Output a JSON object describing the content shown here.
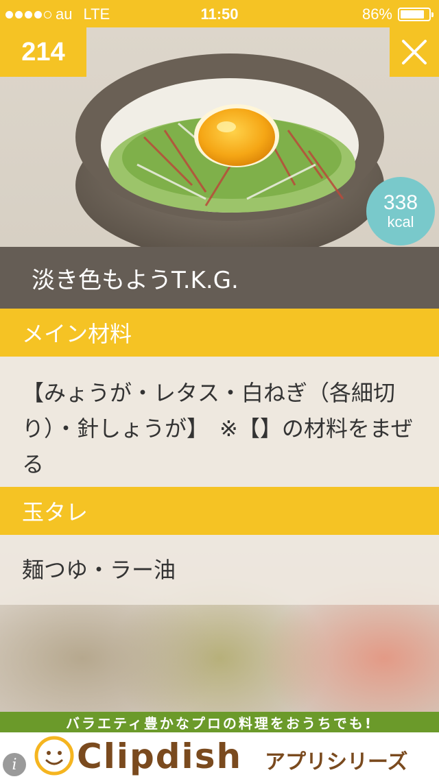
{
  "status_bar": {
    "carrier": "au",
    "network": "LTE",
    "time": "11:50",
    "battery": "86%",
    "battery_level": 0.86
  },
  "recipe": {
    "number": "214",
    "calories_value": "338",
    "calories_unit": "kcal",
    "title": "淡き色もようT.K.G."
  },
  "sections": [
    {
      "header": "メイン材料",
      "body": "【みょうが・レタス・白ねぎ（各細切り）・針しょうが】　※【】の材料をまぜる"
    },
    {
      "header": "玉タレ",
      "body": "麺つゆ・ラー油"
    }
  ],
  "ad": {
    "tagline": "バラエティ豊かなプロの料理をおうちでも!",
    "brand": "Clipdish",
    "series": "アプリシリーズ"
  },
  "colors": {
    "accent": "#f5c324",
    "title_bar": "#655d55",
    "kcal_badge": "#79c9cb",
    "ad_green": "#6b9a2a",
    "brand_brown": "#7a4a1e"
  }
}
